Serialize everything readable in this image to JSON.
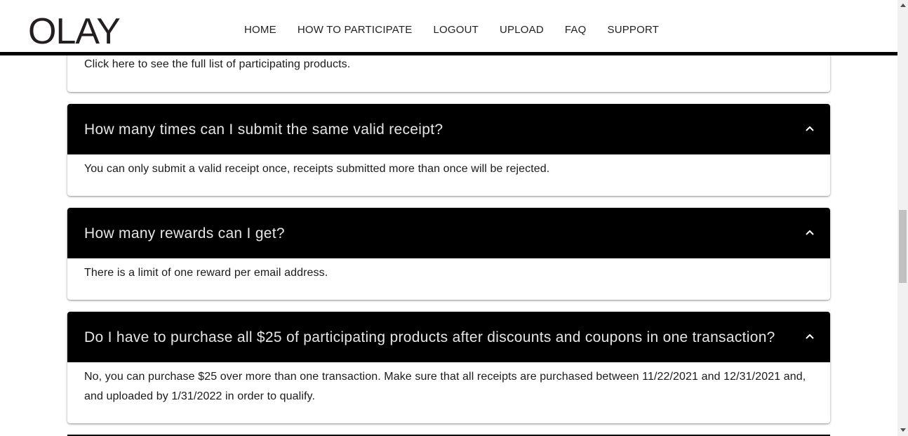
{
  "header": {
    "logo_text": "OLAY",
    "nav": [
      "HOME",
      "HOW TO PARTICIPATE",
      "LOGOUT",
      "UPLOAD",
      "FAQ",
      "SUPPORT"
    ]
  },
  "faq": {
    "partial_answer": "Click here to see the full list of participating products.",
    "items": [
      {
        "question": "How many times can I submit the same valid receipt?",
        "answer": "You can only submit a valid receipt once, receipts submitted more than once will be rejected."
      },
      {
        "question": "How many rewards can I get?",
        "answer": "There is a limit of one reward per email address."
      },
      {
        "question": "Do I have to purchase all $25 of participating products after discounts and coupons in one transaction?",
        "answer": "No, you can purchase $25 over more than one transaction. Make sure that all receipts are purchased between 11/22/2021 and 12/31/2021 and, and uploaded by 1/31/2022 in order to qualify."
      }
    ]
  },
  "colors": {
    "question_bg": "#000000",
    "question_text": "#e6e6e6",
    "answer_text": "#1a1a1a"
  }
}
